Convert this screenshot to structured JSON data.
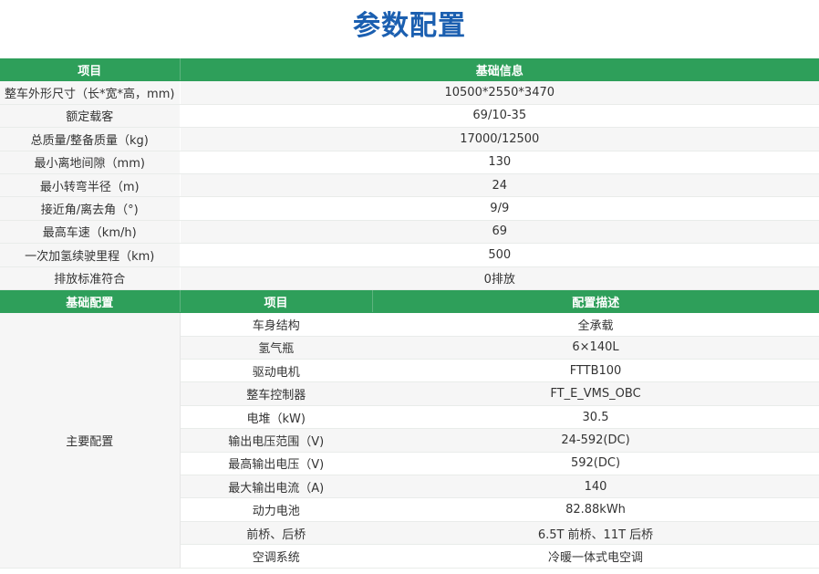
{
  "title": "参数配置",
  "table1": {
    "headers": [
      "项目",
      "基础信息"
    ],
    "rows": [
      [
        "整车外形尺寸（长*宽*高，mm)",
        "10500*2550*3470"
      ],
      [
        "额定载客",
        "69/10-35"
      ],
      [
        "总质量/整备质量（kg)",
        "17000/12500"
      ],
      [
        "最小离地间隙（mm)",
        "130"
      ],
      [
        "最小转弯半径（m)",
        "24"
      ],
      [
        "接近角/离去角（°)",
        "9/9"
      ],
      [
        "最高车速（km/h)",
        "69"
      ],
      [
        "一次加氢续驶里程（km)",
        "500"
      ],
      [
        "排放标准符合",
        "0排放"
      ]
    ]
  },
  "table2": {
    "headers": [
      "基础配置",
      "项目",
      "配置描述"
    ],
    "group_label": "主要配置",
    "rows": [
      [
        "车身结构",
        "全承载"
      ],
      [
        "氢气瓶",
        "6×140L"
      ],
      [
        "驱动电机",
        "FTTB100"
      ],
      [
        "整车控制器",
        "FT_E_VMS_OBC"
      ],
      [
        "电堆（kW)",
        "30.5"
      ],
      [
        "输出电压范围（V)",
        "24-592(DC)"
      ],
      [
        "最高输出电压（V)",
        "592(DC)"
      ],
      [
        "最大输出电流（A)",
        "140"
      ],
      [
        "动力电池",
        "82.88kWh"
      ],
      [
        "前桥、后桥",
        "6.5T 前桥、11T 后桥"
      ],
      [
        "空调系统",
        "冷暖一体式电空调"
      ]
    ]
  }
}
